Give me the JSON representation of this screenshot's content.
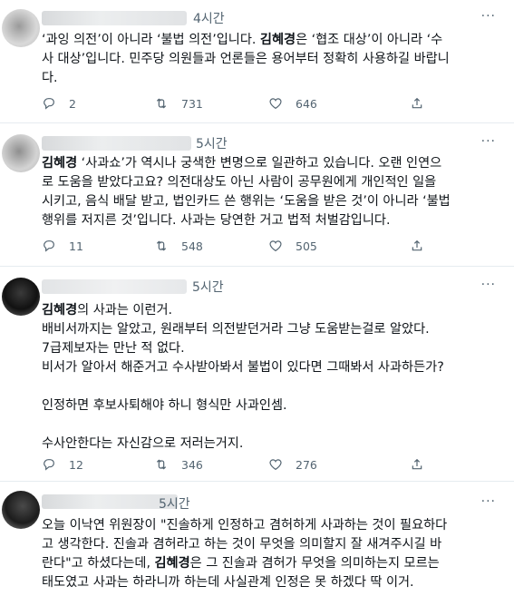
{
  "tweets": [
    {
      "time": "4시간",
      "text_parts": [
        {
          "t": "‘과잉 의전’이 아니라 ‘불법 의전’입니다. "
        },
        {
          "t": "김혜경",
          "b": true
        },
        {
          "t": "은 ‘협조 대상’이 아니라 ‘수\n사 대상’입니다. 민주당 의원들과 언론들은 용어부터 정확히 사용하길 바랍니\n다."
        }
      ],
      "replies": "2",
      "retweets": "731",
      "likes": "646"
    },
    {
      "time": "5시간",
      "text_parts": [
        {
          "t": "김혜경",
          "b": true
        },
        {
          "t": " ‘사과쇼’가 역시나 궁색한 변명으로 일관하고 있습니다. 오랜 인연으\n로 도움을 받았다고요? 의전대상도 아닌 사람이 공무원에게 개인적인 일을\n시키고, 음식 배달 받고, 법인카드 쓴 행위는 ‘도움을 받은 것’이 아니라 ‘불법\n행위를 저지른 것’입니다. 사과는 당연한 거고 법적 처벌감입니다."
        }
      ],
      "replies": "11",
      "retweets": "548",
      "likes": "505"
    },
    {
      "time": "5시간",
      "text_parts": [
        {
          "t": "김혜경",
          "b": true
        },
        {
          "t": "의 사과는 이런거.\n배비서까지는 알았고, 원래부터 의전받던거라 그냥 도움받는걸로 알았다.\n7급제보자는 만난 적 없다.\n비서가 알아서 해준거고 수사받아봐서 불법이 있다면 그때봐서 사과하든가?\n\n인정하면 후보사퇴해야 하니 형식만 사과인셈.\n\n수사안한다는 자신감으로 저러는거지."
        }
      ],
      "replies": "12",
      "retweets": "346",
      "likes": "276"
    },
    {
      "time": "5시간",
      "text_parts": [
        {
          "t": "오늘 이낙연 위원장이 \"진솔하게 인정하고 겸허하게 사과하는 것이 필요하다\n고 생각한다. 진솔과 겸허라고 하는 것이 무엇을 의미할지 잘 새겨주시길 바\n란다\"고 하셨다는데, "
        },
        {
          "t": "김혜경",
          "b": true
        },
        {
          "t": "은 그 진솔과 겸허가 무엇을 의미하는지 모르는\n태도였고 사과는 하라니까 하는데 사실관계 인정은 못 하겠다 딱 이거."
        }
      ]
    }
  ],
  "more_label": "···"
}
